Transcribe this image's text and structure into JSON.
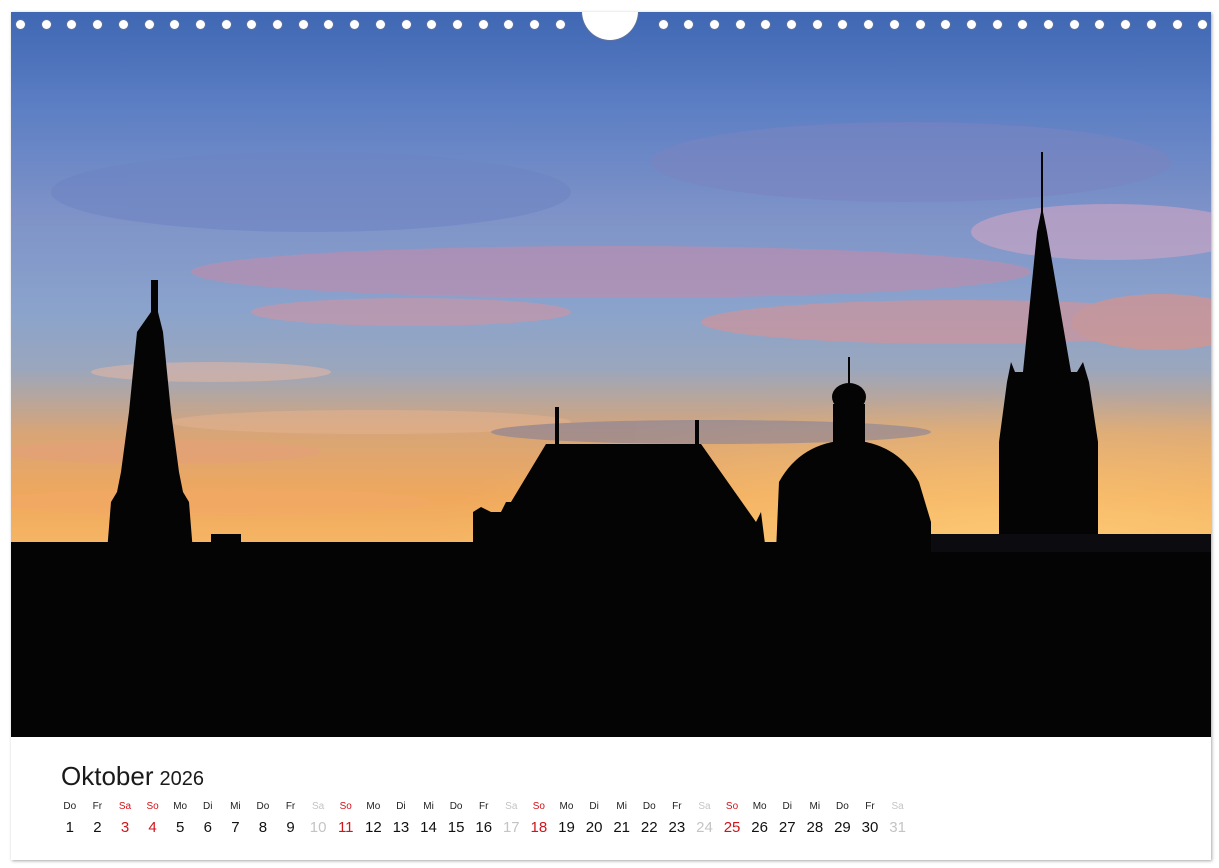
{
  "calendar": {
    "month": "Oktober",
    "year": "2026",
    "days": [
      {
        "wd": "Do",
        "n": "1",
        "style": "normal"
      },
      {
        "wd": "Fr",
        "n": "2",
        "style": "normal"
      },
      {
        "wd": "Sa",
        "n": "3",
        "style": "sat-red"
      },
      {
        "wd": "So",
        "n": "4",
        "style": "sun"
      },
      {
        "wd": "Mo",
        "n": "5",
        "style": "normal"
      },
      {
        "wd": "Di",
        "n": "6",
        "style": "normal"
      },
      {
        "wd": "Mi",
        "n": "7",
        "style": "normal"
      },
      {
        "wd": "Do",
        "n": "8",
        "style": "normal"
      },
      {
        "wd": "Fr",
        "n": "9",
        "style": "normal"
      },
      {
        "wd": "Sa",
        "n": "10",
        "style": "sat-grey"
      },
      {
        "wd": "So",
        "n": "11",
        "style": "sun"
      },
      {
        "wd": "Mo",
        "n": "12",
        "style": "normal"
      },
      {
        "wd": "Di",
        "n": "13",
        "style": "normal"
      },
      {
        "wd": "Mi",
        "n": "14",
        "style": "normal"
      },
      {
        "wd": "Do",
        "n": "15",
        "style": "normal"
      },
      {
        "wd": "Fr",
        "n": "16",
        "style": "normal"
      },
      {
        "wd": "Sa",
        "n": "17",
        "style": "sat-grey"
      },
      {
        "wd": "So",
        "n": "18",
        "style": "sun"
      },
      {
        "wd": "Mo",
        "n": "19",
        "style": "normal"
      },
      {
        "wd": "Di",
        "n": "20",
        "style": "normal"
      },
      {
        "wd": "Mi",
        "n": "21",
        "style": "normal"
      },
      {
        "wd": "Do",
        "n": "22",
        "style": "normal"
      },
      {
        "wd": "Fr",
        "n": "23",
        "style": "normal"
      },
      {
        "wd": "Sa",
        "n": "24",
        "style": "sat-grey"
      },
      {
        "wd": "So",
        "n": "25",
        "style": "sun"
      },
      {
        "wd": "Mo",
        "n": "26",
        "style": "normal"
      },
      {
        "wd": "Di",
        "n": "27",
        "style": "normal"
      },
      {
        "wd": "Mi",
        "n": "28",
        "style": "normal"
      },
      {
        "wd": "Do",
        "n": "29",
        "style": "normal"
      },
      {
        "wd": "Fr",
        "n": "30",
        "style": "normal"
      },
      {
        "wd": "Sa",
        "n": "31",
        "style": "sat-grey"
      }
    ]
  },
  "colors": {
    "sunday": "#d0141a",
    "muted": "#c4c4c4",
    "text": "#1a1a1a"
  },
  "photo": {
    "subject": "city-skyline-silhouette-at-dusk"
  }
}
